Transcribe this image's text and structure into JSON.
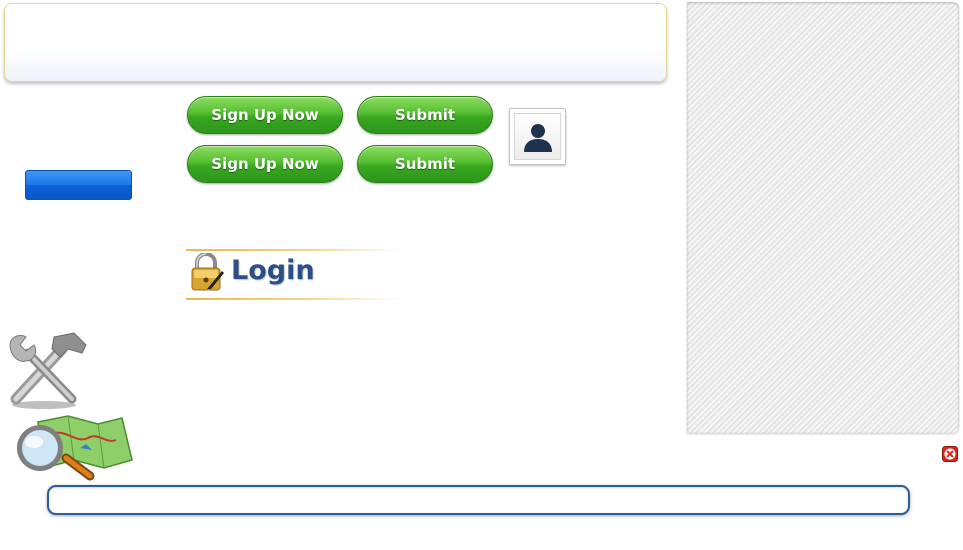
{
  "buttons": {
    "signup_1": "Sign Up Now",
    "signup_2": "Sign Up Now",
    "submit_1": "Submit",
    "submit_2": "Submit",
    "blue": ""
  },
  "login": {
    "title": "Login"
  },
  "search": {
    "value": "",
    "placeholder": ""
  },
  "icons": {
    "avatar": "user-avatar-icon",
    "lock": "padlock-icon",
    "tools": "wrench-hammer-icon",
    "map": "map-magnifier-icon",
    "close": "close-icon"
  },
  "colors": {
    "green_button": "#3aa821",
    "blue_button": "#1a78e8",
    "login_text": "#2b4f86",
    "search_border": "#2d5e9c",
    "close_red": "#d9281c"
  }
}
